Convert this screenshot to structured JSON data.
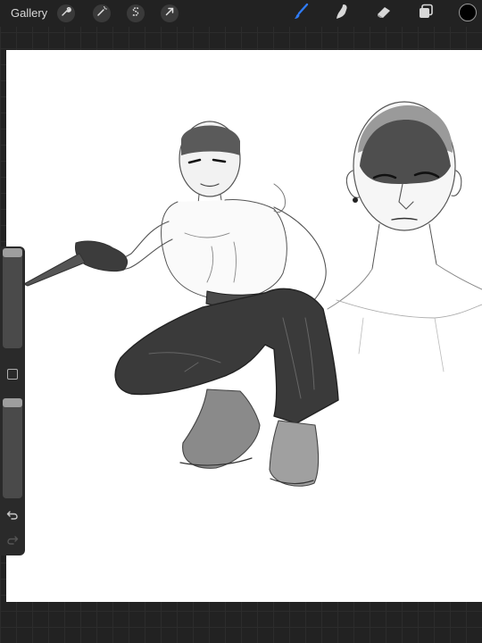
{
  "toolbar": {
    "gallery_label": "Gallery",
    "left_tools": [
      {
        "name": "actions",
        "icon": "wrench-icon"
      },
      {
        "name": "adjustments",
        "icon": "magic-wand-icon"
      },
      {
        "name": "selection",
        "icon": "selection-s-icon"
      },
      {
        "name": "transform",
        "icon": "arrow-cursor-icon"
      }
    ],
    "right_tools": [
      {
        "name": "brush",
        "icon": "brush-icon",
        "active": true
      },
      {
        "name": "smudge",
        "icon": "smudge-finger-icon",
        "active": false
      },
      {
        "name": "eraser",
        "icon": "eraser-icon",
        "active": false
      },
      {
        "name": "layers",
        "icon": "layers-icon",
        "active": false
      }
    ],
    "current_color": "#000000"
  },
  "sidebar": {
    "brush_size_icon": "brush-size-slider",
    "opacity_icon": "opacity-slider",
    "modify_icon": "square-modify-icon",
    "undo_icon": "undo-arrow-icon",
    "redo_icon": "redo-arrow-icon",
    "redo_enabled": false
  },
  "colors": {
    "accent": "#2f7bf5",
    "chrome": "#222222",
    "canvas": "#ffffff"
  }
}
